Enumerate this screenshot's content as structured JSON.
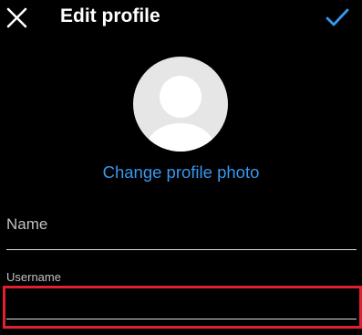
{
  "header": {
    "close_icon": "close-icon",
    "title": "Edit profile",
    "confirm_icon": "checkmark-icon"
  },
  "profile_photo": {
    "avatar_icon": "default-avatar-icon",
    "change_photo_label": "Change profile photo"
  },
  "form": {
    "name_label": "Name",
    "name_value": "",
    "username_label": "Username",
    "username_value": ""
  },
  "colors": {
    "background": "#000000",
    "accent": "#3897f0",
    "text": "#ffffff",
    "label": "#c2c2c2",
    "divider": "#dcdcdc",
    "avatar_bg": "#e6e6e6",
    "highlight": "#e0202e"
  }
}
